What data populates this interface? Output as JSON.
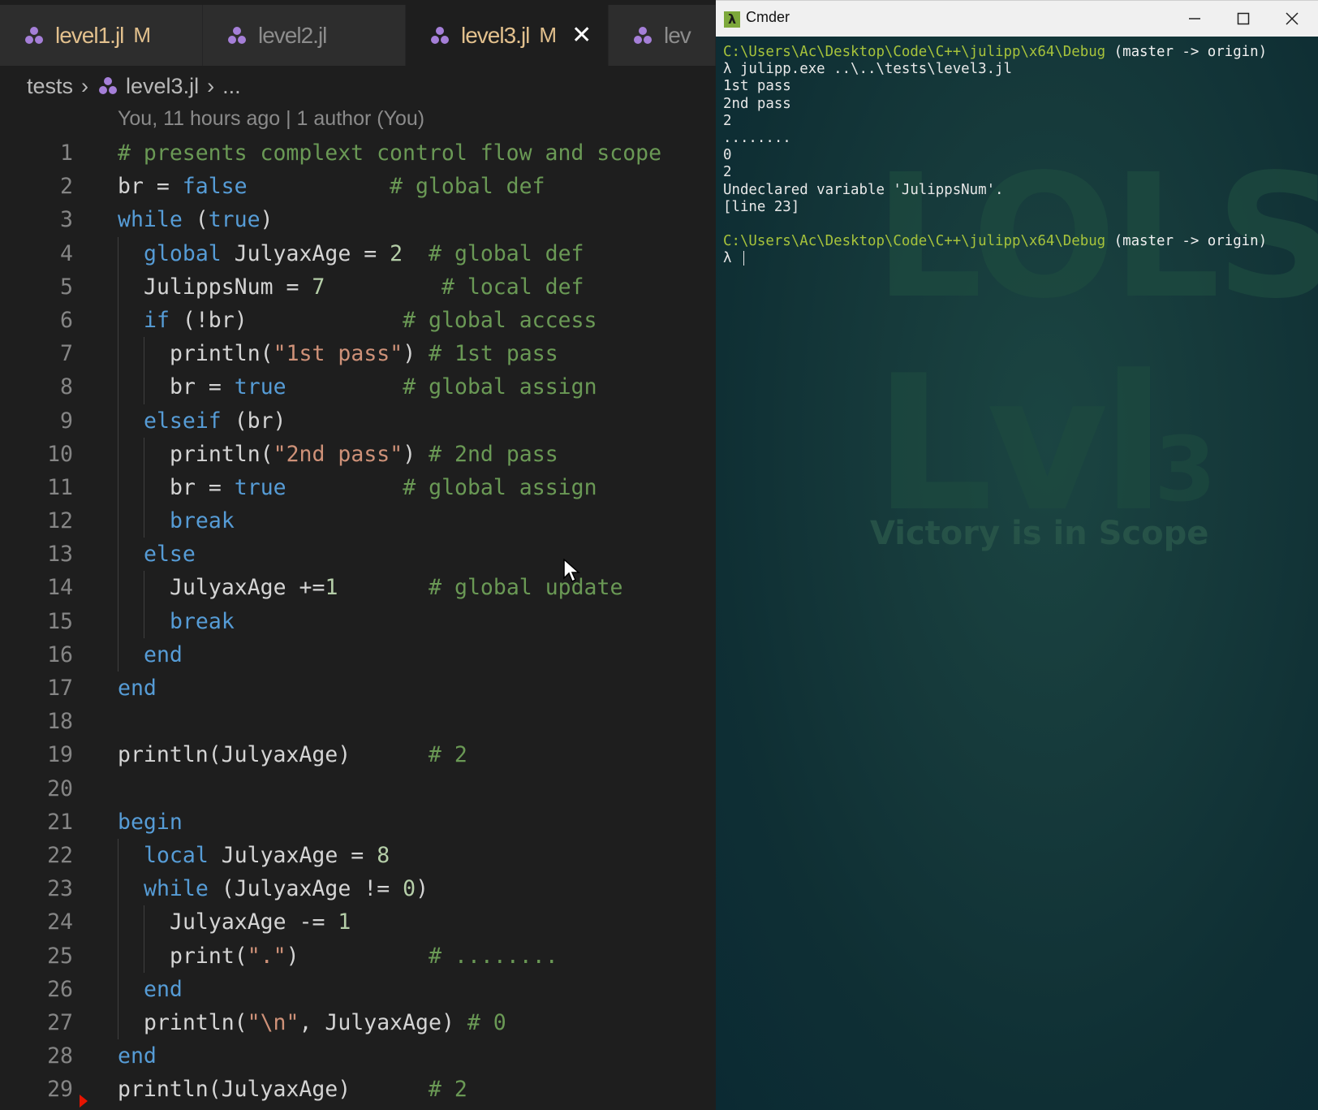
{
  "editor": {
    "tabs": [
      {
        "label": "level1.jl",
        "badge": "M",
        "active": false,
        "modified": true
      },
      {
        "label": "level2.jl",
        "badge": "",
        "active": false,
        "modified": false
      },
      {
        "label": "level3.jl",
        "badge": "M",
        "active": true,
        "modified": true
      },
      {
        "label": "lev",
        "badge": "",
        "active": false,
        "modified": false
      }
    ],
    "close_glyph": "✕",
    "breadcrumb": {
      "folder": "tests",
      "file": "level3.jl",
      "more": "..."
    },
    "blame": "You, 11 hours ago | 1 author (You)",
    "lines": [
      {
        "n": "1",
        "indent": 0,
        "tokens": [
          {
            "c": "cm",
            "t": "# presents complext control flow and scope"
          }
        ]
      },
      {
        "n": "2",
        "indent": 0,
        "tokens": [
          {
            "c": "id",
            "t": "br = "
          },
          {
            "c": "kw",
            "t": "false"
          },
          {
            "c": "id",
            "t": "           "
          },
          {
            "c": "cm",
            "t": "# global def"
          }
        ]
      },
      {
        "n": "3",
        "indent": 0,
        "tokens": [
          {
            "c": "kw",
            "t": "while"
          },
          {
            "c": "id",
            "t": " ("
          },
          {
            "c": "kw",
            "t": "true"
          },
          {
            "c": "id",
            "t": ")"
          }
        ]
      },
      {
        "n": "4",
        "indent": 1,
        "tokens": [
          {
            "c": "kw",
            "t": "global"
          },
          {
            "c": "id",
            "t": " JulyaxAge = "
          },
          {
            "c": "num",
            "t": "2"
          },
          {
            "c": "id",
            "t": "  "
          },
          {
            "c": "cm",
            "t": "# global def"
          }
        ]
      },
      {
        "n": "5",
        "indent": 1,
        "tokens": [
          {
            "c": "id",
            "t": "JulippsNum = "
          },
          {
            "c": "num",
            "t": "7"
          },
          {
            "c": "id",
            "t": "         "
          },
          {
            "c": "cm",
            "t": "# local def"
          }
        ]
      },
      {
        "n": "6",
        "indent": 1,
        "tokens": [
          {
            "c": "kw",
            "t": "if"
          },
          {
            "c": "id",
            "t": " (!br)            "
          },
          {
            "c": "cm",
            "t": "# global access"
          }
        ]
      },
      {
        "n": "7",
        "indent": 2,
        "tokens": [
          {
            "c": "id",
            "t": "println("
          },
          {
            "c": "str",
            "t": "\"1st pass\""
          },
          {
            "c": "id",
            "t": ") "
          },
          {
            "c": "cm",
            "t": "# 1st pass"
          }
        ]
      },
      {
        "n": "8",
        "indent": 2,
        "tokens": [
          {
            "c": "id",
            "t": "br = "
          },
          {
            "c": "kw",
            "t": "true"
          },
          {
            "c": "id",
            "t": "         "
          },
          {
            "c": "cm",
            "t": "# global assign"
          }
        ]
      },
      {
        "n": "9",
        "indent": 1,
        "tokens": [
          {
            "c": "kw",
            "t": "elseif"
          },
          {
            "c": "id",
            "t": " (br)"
          }
        ]
      },
      {
        "n": "10",
        "indent": 2,
        "tokens": [
          {
            "c": "id",
            "t": "println("
          },
          {
            "c": "str",
            "t": "\"2nd pass\""
          },
          {
            "c": "id",
            "t": ") "
          },
          {
            "c": "cm",
            "t": "# 2nd pass"
          }
        ]
      },
      {
        "n": "11",
        "indent": 2,
        "tokens": [
          {
            "c": "id",
            "t": "br = "
          },
          {
            "c": "kw",
            "t": "true"
          },
          {
            "c": "id",
            "t": "         "
          },
          {
            "c": "cm",
            "t": "# global assign"
          }
        ]
      },
      {
        "n": "12",
        "indent": 2,
        "tokens": [
          {
            "c": "kw",
            "t": "break"
          }
        ]
      },
      {
        "n": "13",
        "indent": 1,
        "tokens": [
          {
            "c": "kw",
            "t": "else"
          }
        ]
      },
      {
        "n": "14",
        "indent": 2,
        "tokens": [
          {
            "c": "id",
            "t": "JulyaxAge +="
          },
          {
            "c": "num",
            "t": "1"
          },
          {
            "c": "id",
            "t": "       "
          },
          {
            "c": "cm",
            "t": "# global update"
          }
        ]
      },
      {
        "n": "15",
        "indent": 2,
        "tokens": [
          {
            "c": "kw",
            "t": "break"
          }
        ]
      },
      {
        "n": "16",
        "indent": 1,
        "tokens": [
          {
            "c": "kw",
            "t": "end"
          }
        ]
      },
      {
        "n": "17",
        "indent": 0,
        "tokens": [
          {
            "c": "kw",
            "t": "end"
          }
        ]
      },
      {
        "n": "18",
        "indent": 0,
        "tokens": []
      },
      {
        "n": "19",
        "indent": 0,
        "tokens": [
          {
            "c": "id",
            "t": "println(JulyaxAge)      "
          },
          {
            "c": "cm",
            "t": "# 2"
          }
        ]
      },
      {
        "n": "20",
        "indent": 0,
        "tokens": []
      },
      {
        "n": "21",
        "indent": 0,
        "tokens": [
          {
            "c": "kw",
            "t": "begin"
          }
        ]
      },
      {
        "n": "22",
        "indent": 1,
        "tokens": [
          {
            "c": "kw",
            "t": "local"
          },
          {
            "c": "id",
            "t": " JulyaxAge = "
          },
          {
            "c": "num",
            "t": "8"
          }
        ]
      },
      {
        "n": "23",
        "indent": 1,
        "tokens": [
          {
            "c": "kw",
            "t": "while"
          },
          {
            "c": "id",
            "t": " (JulyaxAge != "
          },
          {
            "c": "num",
            "t": "0"
          },
          {
            "c": "id",
            "t": ")"
          }
        ]
      },
      {
        "n": "24",
        "indent": 2,
        "tokens": [
          {
            "c": "id",
            "t": "JulyaxAge -= "
          },
          {
            "c": "num",
            "t": "1"
          }
        ]
      },
      {
        "n": "25",
        "indent": 2,
        "tokens": [
          {
            "c": "id",
            "t": "print("
          },
          {
            "c": "str",
            "t": "\".\""
          },
          {
            "c": "id",
            "t": ")          "
          },
          {
            "c": "cm",
            "t": "# ........"
          }
        ]
      },
      {
        "n": "26",
        "indent": 1,
        "tokens": [
          {
            "c": "kw",
            "t": "end"
          }
        ]
      },
      {
        "n": "27",
        "indent": 1,
        "tokens": [
          {
            "c": "id",
            "t": "println("
          },
          {
            "c": "str",
            "t": "\"\\n\""
          },
          {
            "c": "id",
            "t": ", JulyaxAge) "
          },
          {
            "c": "cm",
            "t": "# 0"
          }
        ]
      },
      {
        "n": "28",
        "indent": 0,
        "tokens": [
          {
            "c": "kw",
            "t": "end"
          }
        ]
      },
      {
        "n": "29",
        "indent": 0,
        "tokens": [
          {
            "c": "id",
            "t": "println(JulyaxAge)      "
          },
          {
            "c": "cm",
            "t": "# 2"
          }
        ]
      }
    ]
  },
  "terminal": {
    "window_title": "Cmder",
    "app_icon_glyph": "λ",
    "watermark": {
      "line1": "LOLS",
      "line2": "Lvl",
      "line2_suffix": "3",
      "tagline": "Victory is in Scope"
    },
    "lines": [
      {
        "parts": [
          {
            "c": "path",
            "t": "C:\\Users\\Ac\\Desktop\\Code\\C++\\julipp\\x64\\Debug"
          },
          {
            "c": "branch",
            "t": " (master -> origin)"
          }
        ]
      },
      {
        "parts": [
          {
            "c": "out",
            "t": "λ julipp.exe ..\\..\\tests\\level3.jl"
          }
        ]
      },
      {
        "parts": [
          {
            "c": "out",
            "t": "1st pass"
          }
        ]
      },
      {
        "parts": [
          {
            "c": "out",
            "t": "2nd pass"
          }
        ]
      },
      {
        "parts": [
          {
            "c": "out",
            "t": "2"
          }
        ]
      },
      {
        "parts": [
          {
            "c": "out",
            "t": "........"
          }
        ]
      },
      {
        "parts": [
          {
            "c": "out",
            "t": "0"
          }
        ]
      },
      {
        "parts": [
          {
            "c": "out",
            "t": "2"
          }
        ]
      },
      {
        "parts": [
          {
            "c": "out",
            "t": "Undeclared variable 'JulippsNum'."
          }
        ]
      },
      {
        "parts": [
          {
            "c": "out",
            "t": "[line 23]"
          }
        ]
      },
      {
        "parts": []
      },
      {
        "parts": [
          {
            "c": "path",
            "t": "C:\\Users\\Ac\\Desktop\\Code\\C++\\julipp\\x64\\Debug"
          },
          {
            "c": "branch",
            "t": " (master -> origin)"
          }
        ]
      },
      {
        "parts": [
          {
            "c": "out",
            "t": "λ "
          }
        ],
        "cursor": true
      }
    ]
  }
}
